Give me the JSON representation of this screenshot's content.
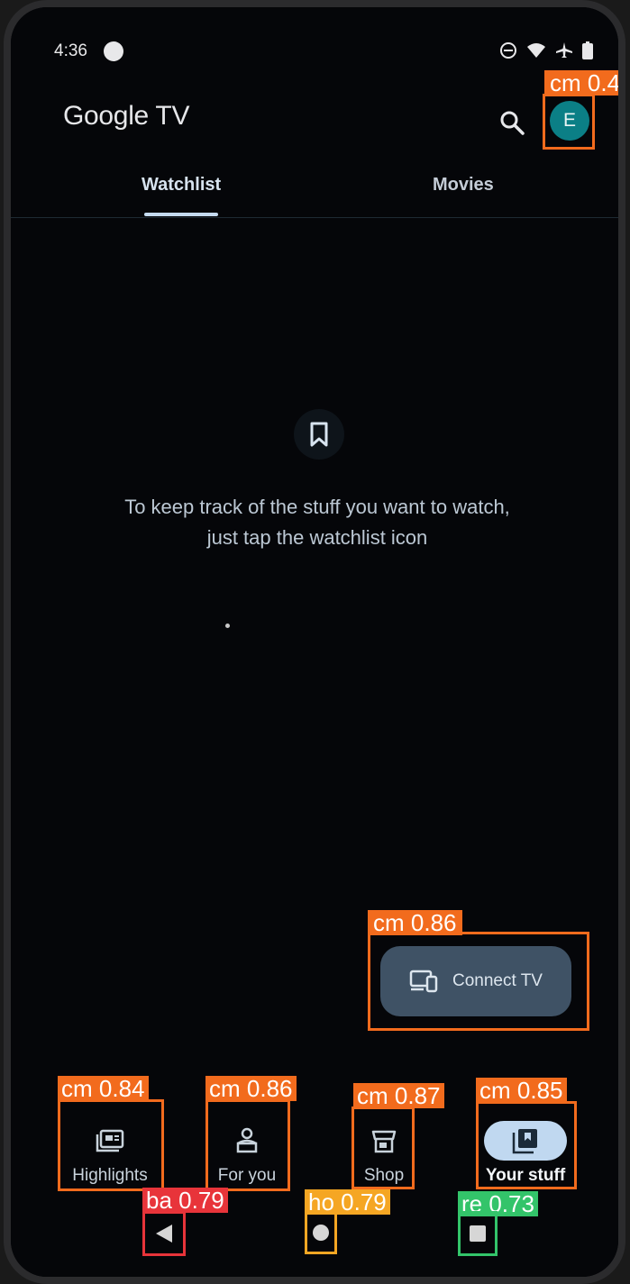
{
  "status_bar": {
    "time": "4:36"
  },
  "app_bar": {
    "title": "Google TV",
    "avatar_letter": "E"
  },
  "tabs": [
    {
      "label": "Watchlist",
      "selected": true
    },
    {
      "label": "Movies",
      "selected": false
    }
  ],
  "empty_state": {
    "line1": "To keep track of the stuff you want to watch,",
    "line2": "just tap the watchlist icon"
  },
  "connect_tv": {
    "label": "Connect TV"
  },
  "bottom_nav": [
    {
      "label": "Highlights",
      "icon": "highlights-icon"
    },
    {
      "label": "For you",
      "icon": "for-you-icon"
    },
    {
      "label": "Shop",
      "icon": "shop-icon"
    },
    {
      "label": "Your stuff",
      "icon": "your-stuff-icon",
      "selected": true
    }
  ],
  "detections": {
    "avatar": "cm 0.4",
    "connect_tv": "cm 0.86",
    "highlights": "cm 0.84",
    "for_you": "cm 0.86",
    "shop": "cm 0.87",
    "your_stuff": "cm 0.85",
    "back": "ba 0.79",
    "home": "ho 0.79",
    "recents": "re 0.73"
  },
  "colors": {
    "background": "#050609",
    "accent": "#c5dbf0",
    "avatar": "#0b7f86",
    "detection_box": "#f26b1d"
  }
}
